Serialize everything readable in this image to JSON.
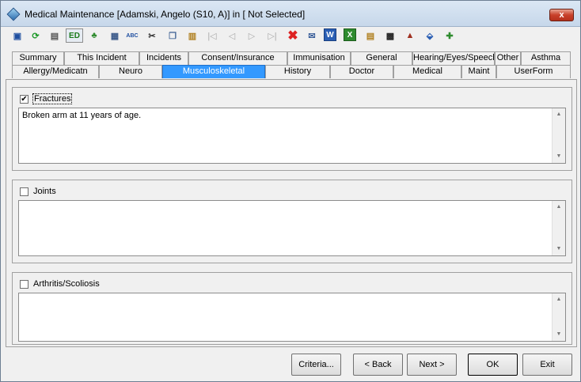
{
  "window": {
    "title": "Medical Maintenance   [Adamski, Angelo (S10, A)] in [ Not Selected]",
    "close_label": "x"
  },
  "toolbar": {
    "icons": [
      "save-icon",
      "refresh-icon",
      "print-icon",
      "ed-icon",
      "tree-icon",
      "calculator-icon",
      "spellcheck-icon",
      "cut-icon",
      "copy-icon",
      "paste-icon",
      "first-record-icon",
      "previous-record-icon",
      "next-record-icon",
      "last-record-icon",
      "delete-icon",
      "email-icon",
      "word-icon",
      "excel-icon",
      "clipboard-icon",
      "film-icon",
      "hat-icon",
      "tag-icon",
      "edit-add-icon"
    ],
    "ed_label": "ED",
    "spellcheck_label": "ABC"
  },
  "tabs_row1": [
    "Summary",
    "This Incident",
    "Incidents",
    "Consent/Insurance",
    "Immunisation",
    "General",
    "Hearing/Eyes/Speech",
    "Other",
    "Asthma"
  ],
  "tabs_row2": [
    "Allergy/Medicatn",
    "Neuro",
    "Musculoskeletal",
    "History",
    "Doctor",
    "Medical",
    "Maint",
    "UserForm"
  ],
  "active_tab": "Musculoskeletal",
  "sections": [
    {
      "label": "Fractures",
      "checked": true,
      "text": "Broken arm at 11 years of age."
    },
    {
      "label": "Joints",
      "checked": false,
      "text": ""
    },
    {
      "label": "Arthritis/Scoliosis",
      "checked": false,
      "text": ""
    }
  ],
  "buttons": {
    "criteria": "Criteria...",
    "back": "< Back",
    "next": "Next >",
    "ok": "OK",
    "exit": "Exit"
  },
  "colors": {
    "active_tab": "#3399ff",
    "delete_icon": "#dd2222"
  }
}
